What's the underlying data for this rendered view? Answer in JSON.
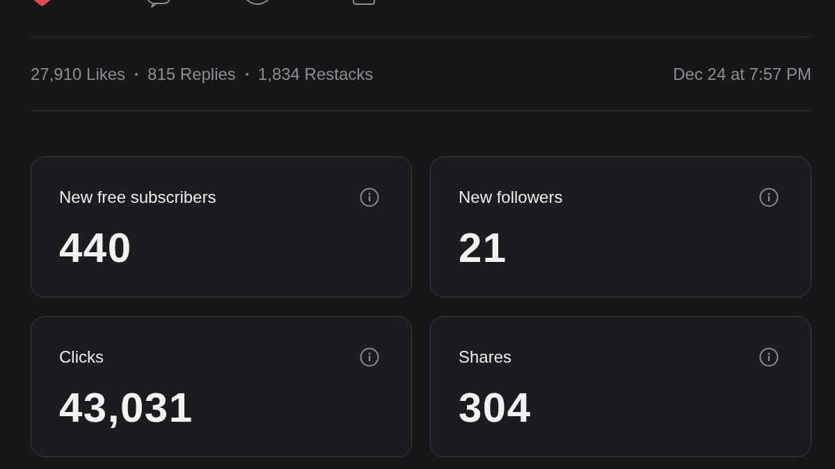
{
  "note_actions": [
    {
      "kind": "like",
      "on": true
    },
    {
      "kind": "reply",
      "on": false
    },
    {
      "kind": "restack",
      "on": false
    },
    {
      "kind": "share",
      "on": false
    }
  ],
  "engagement": {
    "counts": [
      "27,910 Likes",
      "815 Replies",
      "1,834 Restacks"
    ],
    "timestamp": "Dec 24 at 7:57 PM"
  },
  "metrics": [
    {
      "label": "New free subscribers",
      "value": "440"
    },
    {
      "label": "New followers",
      "value": "21"
    },
    {
      "label": "Clicks",
      "value": "43,031"
    },
    {
      "label": "Shares",
      "value": "304"
    }
  ]
}
